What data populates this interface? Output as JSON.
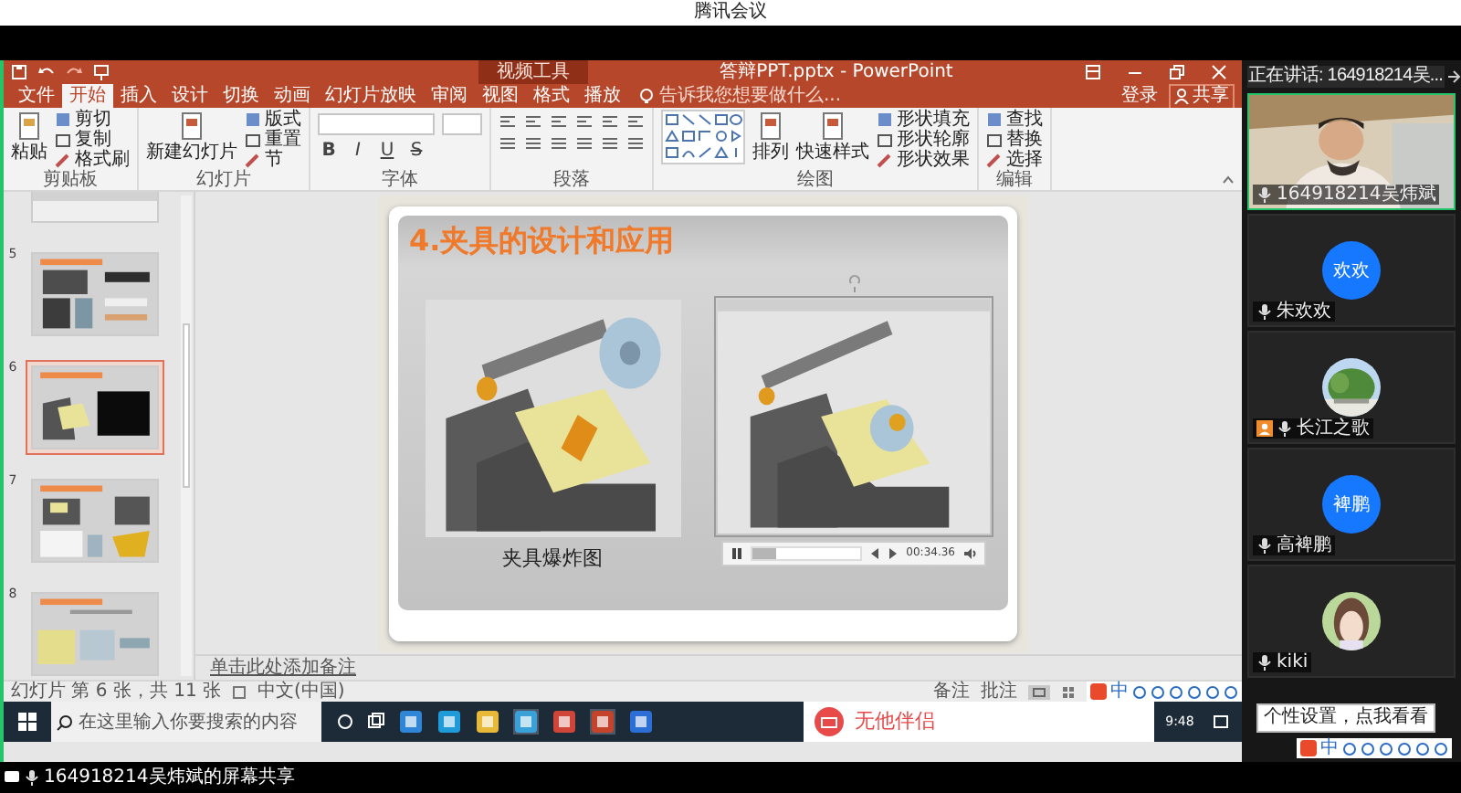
{
  "app_title": "腾讯会议",
  "ppt": {
    "context_tab": "视频工具",
    "doc_title": "答辩PPT.pptx - PowerPoint",
    "tabs": [
      {
        "label": "文件",
        "selected": false
      },
      {
        "label": "开始",
        "selected": true
      },
      {
        "label": "插入",
        "selected": false
      },
      {
        "label": "设计",
        "selected": false
      },
      {
        "label": "切换",
        "selected": false
      },
      {
        "label": "动画",
        "selected": false
      },
      {
        "label": "幻灯片放映",
        "selected": false
      },
      {
        "label": "审阅",
        "selected": false
      },
      {
        "label": "视图",
        "selected": false
      },
      {
        "label": "格式",
        "selected": false
      },
      {
        "label": "播放",
        "selected": false
      }
    ],
    "tell_me": "告诉我您想要做什么...",
    "account": {
      "sign_in": "登录",
      "share": "共享"
    },
    "ribbon_groups": [
      {
        "label": "剪贴板",
        "items": [
          {
            "kind": "large",
            "label": "粘贴"
          },
          {
            "kind": "small",
            "label": "剪切"
          },
          {
            "kind": "small",
            "label": "复制"
          },
          {
            "kind": "small",
            "label": "格式刷"
          }
        ]
      },
      {
        "label": "幻灯片",
        "items": [
          {
            "kind": "large",
            "label": "新建幻灯片"
          },
          {
            "kind": "small",
            "label": "版式"
          },
          {
            "kind": "small",
            "label": "重置"
          },
          {
            "kind": "small",
            "label": "节"
          }
        ]
      },
      {
        "label": "字体",
        "items": [
          {
            "kind": "font",
            "buttons": [
              "B",
              "I",
              "U",
              "S"
            ]
          }
        ]
      },
      {
        "label": "段落",
        "items": [
          {
            "kind": "paragraph"
          }
        ]
      },
      {
        "label": "绘图",
        "items": [
          {
            "kind": "gallery"
          },
          {
            "kind": "large",
            "label": "排列"
          },
          {
            "kind": "large",
            "label": "快速样式"
          },
          {
            "kind": "small",
            "label": "形状填充"
          },
          {
            "kind": "small",
            "label": "形状轮廓"
          },
          {
            "kind": "small",
            "label": "形状效果"
          }
        ]
      },
      {
        "label": "编辑",
        "items": [
          {
            "kind": "small",
            "label": "查找"
          },
          {
            "kind": "small",
            "label": "替换"
          },
          {
            "kind": "small",
            "label": "选择"
          }
        ]
      }
    ],
    "thumbnails": [
      {
        "selected": false
      },
      {
        "number": "5",
        "selected": false
      },
      {
        "number": "6",
        "selected": true
      },
      {
        "number": "7",
        "selected": false
      },
      {
        "number": "8",
        "selected": false
      }
    ],
    "slide": {
      "title": "4.夹具的设计和应用",
      "caption": "夹具爆炸图",
      "video": {
        "time": "00:34.36",
        "level": 0.22
      }
    },
    "notes_placeholder": "单击此处添加备注",
    "status": {
      "slide_info": "幻灯片 第 6 张，共 11 张",
      "language": "中文(中国)",
      "notes": "备注",
      "comments": "批注",
      "ime": "中"
    }
  },
  "taskbar": {
    "search_placeholder": "在这里输入你要搜索的内容",
    "banner": "无他伴侣",
    "time": "9:48"
  },
  "meeting": {
    "speaking": "正在讲话: 164918214吴...",
    "participants": [
      {
        "kind": "video",
        "name": "164918214吴炜斌",
        "host": false
      },
      {
        "kind": "initials",
        "initials": "欢欢",
        "name": "朱欢欢",
        "host": false
      },
      {
        "kind": "picture",
        "name": "长江之歌",
        "host": true
      },
      {
        "kind": "initials",
        "initials": "裨鹏",
        "name": "高裨鹏",
        "host": false
      },
      {
        "kind": "picture",
        "name": "kiki",
        "host": false
      }
    ],
    "tooltip": "个性设置，点我看看",
    "ime": "中"
  },
  "share_label": "164918214吴炜斌的屏幕共享"
}
